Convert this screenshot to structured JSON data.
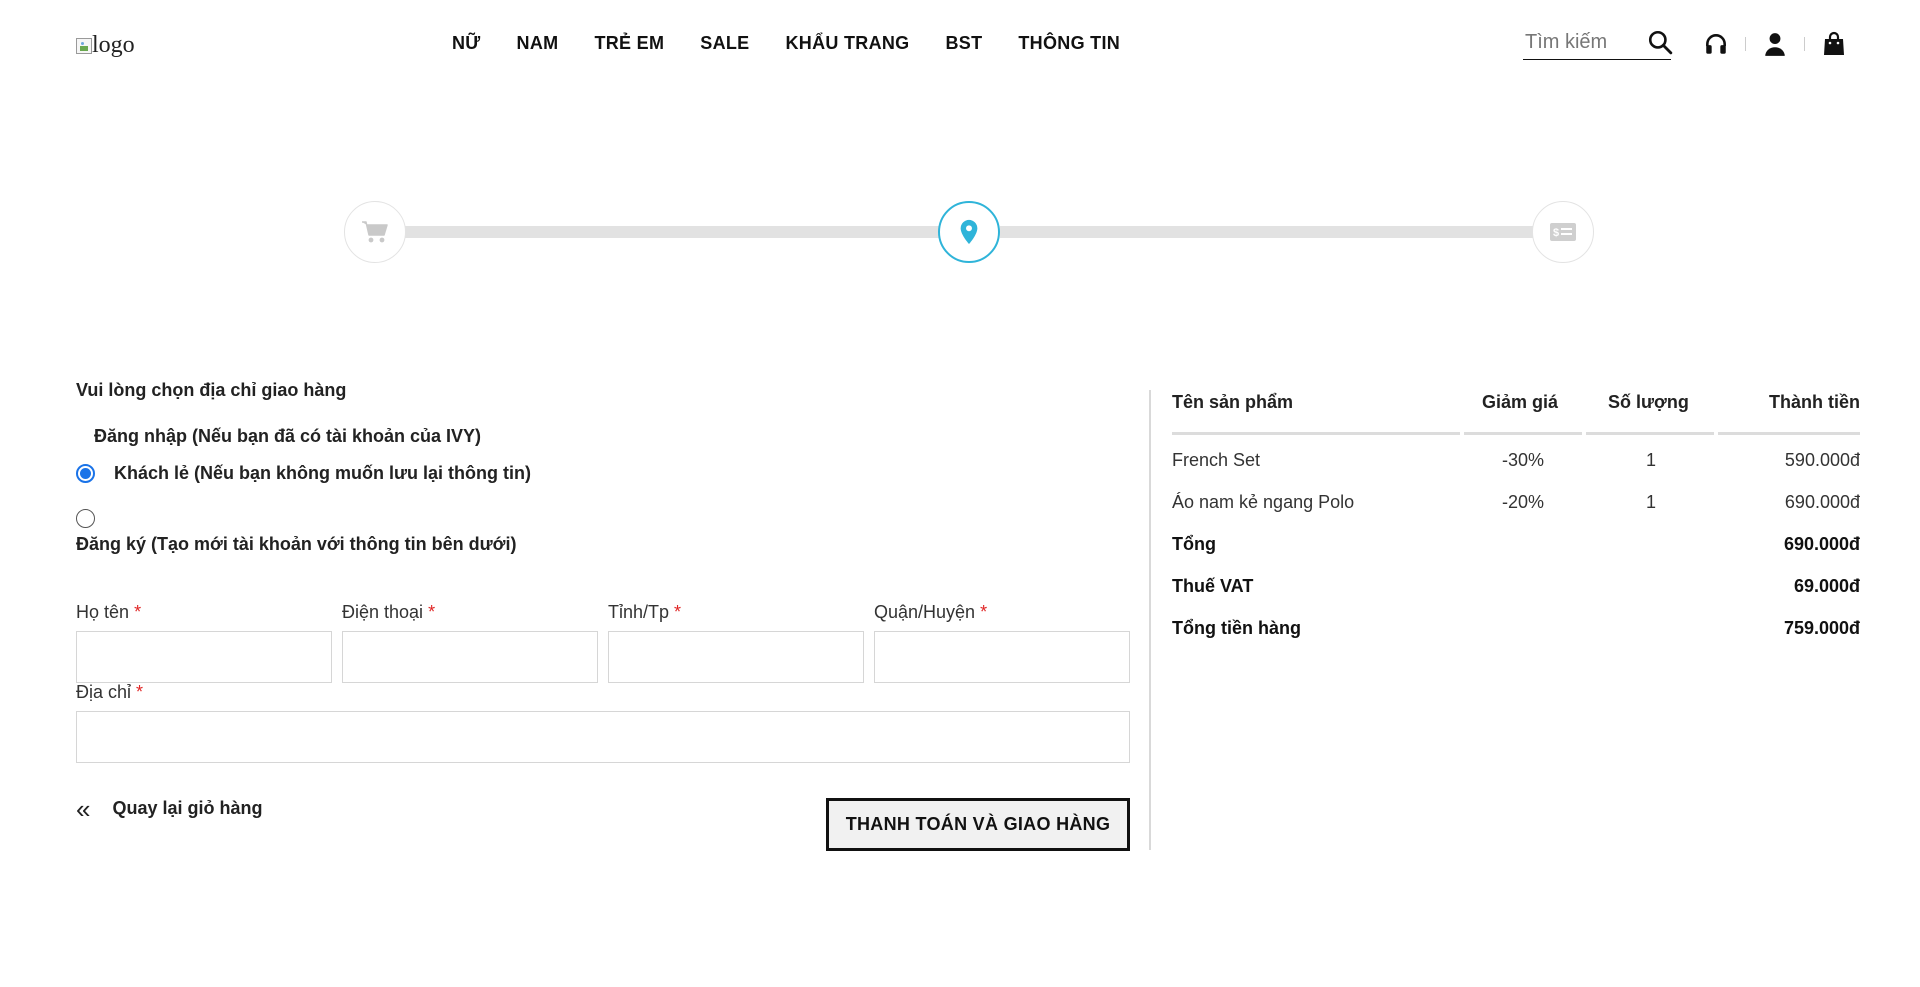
{
  "header": {
    "logo_alt": "logo",
    "nav": [
      "NỮ",
      "NAM",
      "TRẺ EM",
      "SALE",
      "KHẨU TRANG",
      "BST",
      "THÔNG TIN"
    ],
    "search_placeholder": "Tìm kiếm"
  },
  "progress": {
    "steps": [
      "cart-icon",
      "location-pin-icon",
      "payment-icon"
    ],
    "active_step": 2,
    "accent_color": "#2fb4d9"
  },
  "form": {
    "title": "Vui lòng chọn địa chỉ giao hàng",
    "option_login": "Đăng nhập (Nếu bạn đã có tài khoản của IVY)",
    "option_guest": "Khách lẻ (Nếu bạn không muốn lưu lại thông tin)",
    "option_register": "Đăng ký (Tạo mới tài khoản với thông tin bên dưới)",
    "fields": {
      "name": "Họ tên",
      "phone": "Điện thoại",
      "city": "Tỉnh/Tp",
      "district": "Quận/Huyện",
      "address": "Địa chỉ"
    },
    "required_mark": "*",
    "back_chevron": "«",
    "back_label": "Quay lại giỏ hàng",
    "submit_label": "THANH TOÁN VÀ GIAO HÀNG"
  },
  "summary": {
    "headers": [
      "Tên sản phẩm",
      "Giảm giá",
      "Số lượng",
      "Thành tiền"
    ],
    "items": [
      {
        "name": "French Set",
        "discount": "-30%",
        "qty": "1",
        "price": "590.000đ"
      },
      {
        "name": "Áo nam kẻ ngang Polo",
        "discount": "-20%",
        "qty": "1",
        "price": "690.000đ"
      }
    ],
    "total_label": "Tổng",
    "total_value": "690.000đ",
    "vat_label": "Thuế VAT",
    "vat_value": "69.000đ",
    "grand_label": "Tổng tiền hàng",
    "grand_value": "759.000đ"
  }
}
